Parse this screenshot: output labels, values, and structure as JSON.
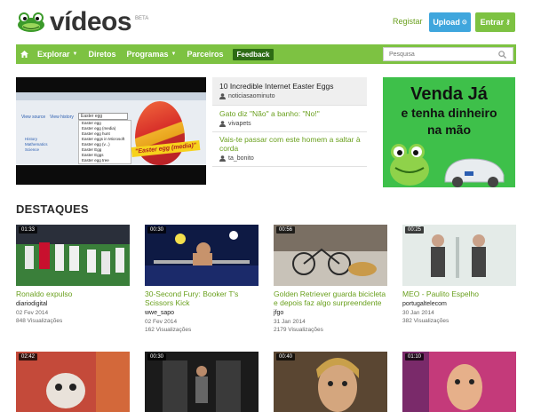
{
  "header": {
    "logo_text": "vídeos",
    "beta": "BETA",
    "register_label": "Registar",
    "upload_label": "Upload",
    "login_label": "Entrar"
  },
  "nav": {
    "items": [
      "Explorar",
      "Diretos",
      "Programas",
      "Parceiros"
    ],
    "feedback_label": "Feedback",
    "search_placeholder": "Pesquisa"
  },
  "featured": {
    "video": {
      "top_links": [
        "View source",
        "View history"
      ],
      "search_query": "Easter egg",
      "suggestions": [
        "Easter egg",
        "Easter egg (media)",
        "Easter egg hunt",
        "Easter eggs in Microsoft",
        "Easter egg (v...)",
        "Easter Egg",
        "Easter Eggs",
        "Easter egg tree"
      ],
      "sidebar_links": [
        "History",
        "Mathematics",
        "Science"
      ],
      "banner": "\"Easter egg (media)\""
    },
    "list": [
      {
        "title": "10 Incredible Internet Easter Eggs",
        "author": "noticiasaominuto"
      },
      {
        "title": "Gato diz \"Não\" a banho: \"No!\"",
        "author": "vivapets"
      },
      {
        "title": "Vais-te passar com este homem a saltar à corda",
        "author": "ta_bonito"
      }
    ]
  },
  "ad": {
    "line1": "Venda Já",
    "line2": "e tenha dinheiro",
    "line3": "na mão"
  },
  "section_title": "DESTAQUES",
  "videos": [
    {
      "duration": "01:33",
      "title": "Ronaldo expulso",
      "author": "diariodigital",
      "date": "02 Fev 2014",
      "views": "848 Visualizações"
    },
    {
      "duration": "00:30",
      "title": "30-Second Fury: Booker T's Scissors Kick",
      "author": "wwe_sapo",
      "date": "02 Fev 2014",
      "views": "162 Visualizações"
    },
    {
      "duration": "00:56",
      "title": "Golden Retriever guarda bicicleta e depois faz algo surpreendente",
      "author": "jfgo",
      "date": "31 Jan 2014",
      "views": "2179 Visualizações"
    },
    {
      "duration": "00:25",
      "title": "MEO - Paulito Espelho",
      "author": "portugaltelecom",
      "date": "30 Jan 2014",
      "views": "382 Visualizações"
    },
    {
      "duration": "02:42"
    },
    {
      "duration": "00:30"
    },
    {
      "duration": "00:40"
    },
    {
      "duration": "01:10"
    }
  ],
  "colors": {
    "brand_green": "#7dc242",
    "dark_green": "#2d6b14",
    "link_green": "#6aa01e",
    "upload_blue": "#3fa6dd"
  }
}
